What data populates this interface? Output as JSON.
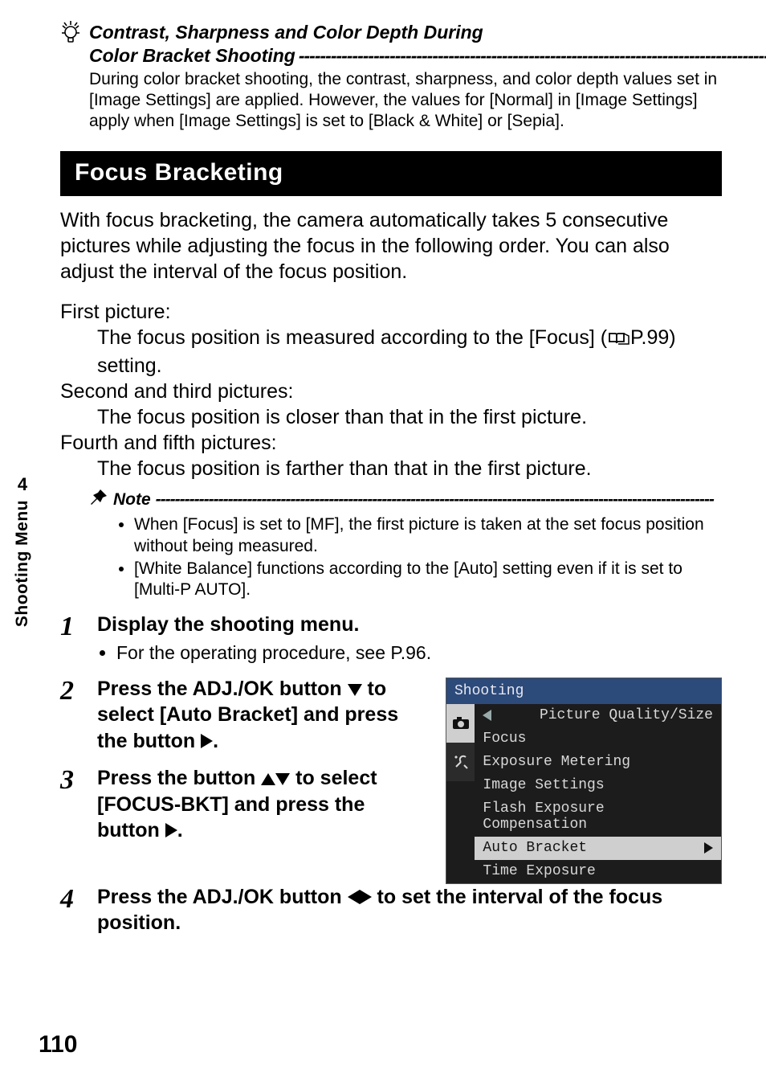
{
  "tip": {
    "title_line1": "Contrast, Sharpness and Color Depth During",
    "title_line2_prefix": "Color Bracket Shooting ",
    "body": "During color bracket shooting, the contrast, sharpness, and color depth values set in [Image Settings] are applied. However, the values for [Normal] in [Image Settings] apply when [Image Settings] is set to [Black & White] or [Sepia]."
  },
  "section_title": "Focus Bracketing",
  "intro": "With focus bracketing, the camera automatically takes 5 consecutive pictures while adjusting the focus in the following order. You can also adjust the interval of the focus position.",
  "pictures": {
    "first_label": "First picture:",
    "first_body_pre": "The focus position is measured according to the [Focus] (",
    "first_body_post": "P.99) setting.",
    "second_label": "Second and third pictures:",
    "second_body": "The focus position is closer than that in the first picture.",
    "fourth_label": "Fourth and fifth pictures:",
    "fourth_body": "The focus position is farther than that in the first picture."
  },
  "note": {
    "title": "Note",
    "items": [
      "When [Focus] is set to [MF], the first picture is taken at the set focus position without being measured.",
      "[White Balance] functions according to the [Auto] setting even if it is set to [Multi-P AUTO]."
    ]
  },
  "steps": {
    "s1": {
      "num": "1",
      "title": "Display the shooting menu.",
      "sub": "For the operating procedure, see P.96."
    },
    "s2": {
      "num": "2",
      "title_a": "Press the ADJ./OK button ",
      "title_b": " to select [Auto Bracket] and press the button ",
      "title_c": "."
    },
    "s3": {
      "num": "3",
      "title_a": "Press the button ",
      "title_b": " to select [FOCUS-BKT] and press the button ",
      "title_c": "."
    },
    "s4": {
      "num": "4",
      "title_a": "Press the ADJ./OK button ",
      "title_b": " to set the interval of the focus position."
    }
  },
  "lcd": {
    "title": "Shooting",
    "items": [
      "Picture Quality/Size",
      "Focus",
      "Exposure Metering",
      "Image Settings",
      "Flash Exposure Compensation",
      "Auto Bracket",
      "Time Exposure"
    ]
  },
  "side": {
    "num": "4",
    "label": "Shooting Menu"
  },
  "page_number": "110",
  "dash_fill": "--------------------------------------------------------------------------------------------------------------------"
}
